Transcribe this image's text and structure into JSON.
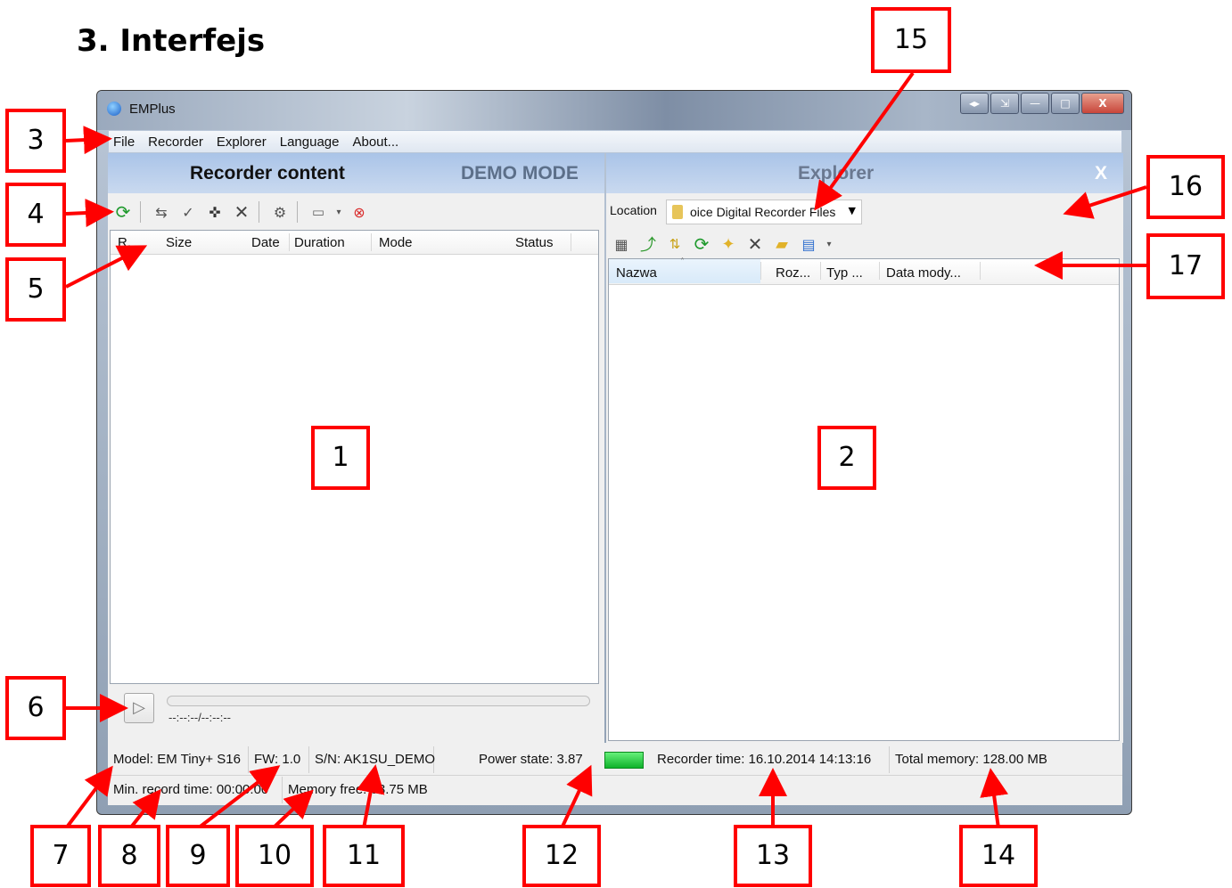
{
  "heading": "3. Interfejs",
  "window": {
    "title": "EMPlus",
    "caption_buttons": [
      "◂▸",
      "⇲",
      "—",
      "□",
      "X"
    ]
  },
  "menu": [
    "File",
    "Recorder",
    "Explorer",
    "Language",
    "About..."
  ],
  "recorder_panel": {
    "title": "Recorder content",
    "mode_label": "DEMO MODE",
    "columns": [
      "R.",
      "Size",
      "Date",
      "Duration",
      "Mode",
      "Status"
    ],
    "toolbar_icons": [
      "refresh-icon",
      "download-icon",
      "download-check-icon",
      "split-icon",
      "delete-icon",
      "settings-icon",
      "usb-icon",
      "dropdown-icon",
      "disconnect-icon"
    ]
  },
  "player": {
    "time": "--:--:--/--:--:--"
  },
  "explorer_panel": {
    "title": "Explorer",
    "close_label": "X",
    "location_label": "Location",
    "location_value": "oice Digital Recorder Files",
    "columns": [
      "Nazwa",
      "Roz...",
      "Typ ...",
      "Data mody..."
    ],
    "toolbar_icons": [
      "properties-icon",
      "up-icon",
      "sync-icon",
      "refresh-icon",
      "new-folder-icon",
      "delete-icon",
      "open-folder-icon",
      "view-icon",
      "dropdown-icon"
    ]
  },
  "status": {
    "model": "Model: EM Tiny+ S16",
    "fw": "FW: 1.0",
    "sn": "S/N: AK1SU_DEMO",
    "power": "Power state: 3.87",
    "recorder_time": "Recorder time: 16.10.2014 14:13:16",
    "total_memory": "Total memory: 128.00 MB",
    "min_record_time": "Min. record time: 00:00:00",
    "memory_free": "Memory free: 63.75 MB"
  },
  "annotations": [
    "1",
    "2",
    "3",
    "4",
    "5",
    "6",
    "7",
    "8",
    "9",
    "10",
    "11",
    "12",
    "13",
    "14",
    "15",
    "16",
    "17"
  ],
  "colors": {
    "annotation": "#ff0000",
    "panel_header": "#b9cff0",
    "led": "#1ec23a"
  }
}
